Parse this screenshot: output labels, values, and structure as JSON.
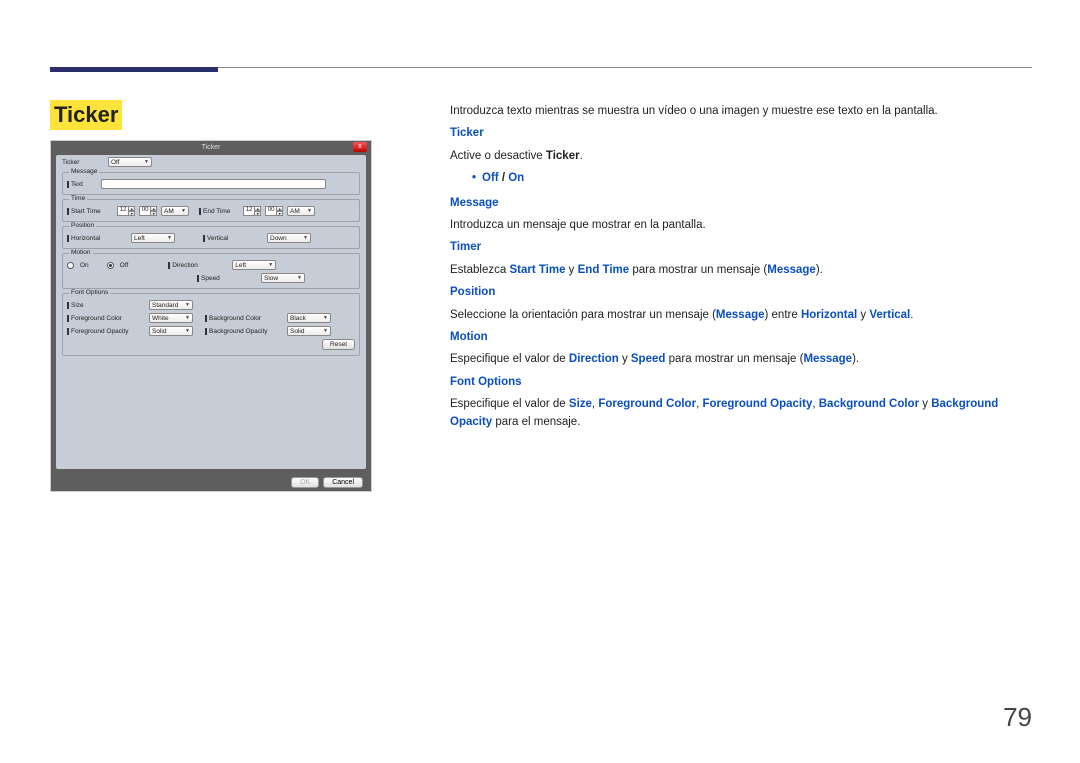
{
  "page_number": "79",
  "heading": "Ticker",
  "dialog": {
    "title": "Ticker",
    "close": "x",
    "ticker_label": "Ticker",
    "ticker_value": "Off",
    "message_fs": "Message",
    "message_label": "Text",
    "time_fs": "Time",
    "start_label": "Start Time",
    "start_h": "12",
    "start_m": "00",
    "start_ampm": "AM",
    "end_label": "End Time",
    "end_h": "12",
    "end_m": "00",
    "end_ampm": "AM",
    "position_fs": "Position",
    "horizontal_label": "Horizontal",
    "horizontal_value": "Left",
    "vertical_label": "Vertical",
    "vertical_value": "Down",
    "motion_fs": "Motion",
    "on_label": "On",
    "off_label": "Off",
    "direction_label": "Direction",
    "direction_value": "Left",
    "speed_label": "Speed",
    "speed_value": "Slow",
    "font_fs": "Font Options",
    "size_label": "Size",
    "size_value": "Standard",
    "fgcolor_label": "Foreground Color",
    "fgcolor_value": "White",
    "fgopacity_label": "Foreground Opacity",
    "fgopacity_value": "Solid",
    "bgcolor_label": "Background Color",
    "bgcolor_value": "Black",
    "bgopacity_label": "Background Opacity",
    "bgopacity_value": "Solid",
    "reset_btn": "Reset",
    "ok_btn": "OK",
    "cancel_btn": "Cancel"
  },
  "desc": {
    "intro": "Introduzca texto mientras se muestra un vídeo o una imagen y muestre ese texto en la pantalla.",
    "ticker_h": "Ticker",
    "ticker_t1": "Active o desactive ",
    "ticker_bold": "Ticker",
    "off": "Off",
    "on": "On",
    "message_h": "Message",
    "message_t": "Introduzca un mensaje que mostrar en la pantalla.",
    "timer_h": "Timer",
    "timer_t1": "Establezca ",
    "timer_b1": "Start Time",
    "timer_t2": " y ",
    "timer_b2": "End Time",
    "timer_t3": " para mostrar un mensaje (",
    "timer_b3": "Message",
    "timer_t4": ").",
    "position_h": "Position",
    "pos_t1": "Seleccione la orientación para mostrar un mensaje (",
    "pos_b1": "Message",
    "pos_t2": ") entre ",
    "pos_b2": "Horizontal",
    "pos_t3": " y ",
    "pos_b3": "Vertical",
    "pos_t4": ".",
    "motion_h": "Motion",
    "mot_t1": "Especifique el valor de ",
    "mot_b1": "Direction",
    "mot_t2": " y ",
    "mot_b2": "Speed",
    "mot_t3": " para mostrar un mensaje (",
    "mot_b3": "Message",
    "mot_t4": ").",
    "font_h": "Font Options",
    "fo_t1": "Especifique el valor de ",
    "fo_b1": "Size",
    "fo_c": ", ",
    "fo_b2": "Foreground Color",
    "fo_b3": "Foreground Opacity",
    "fo_b4": "Background Color",
    "fo_y": " y ",
    "fo_b5": "Background Opacity",
    "fo_t2": " para el mensaje."
  }
}
